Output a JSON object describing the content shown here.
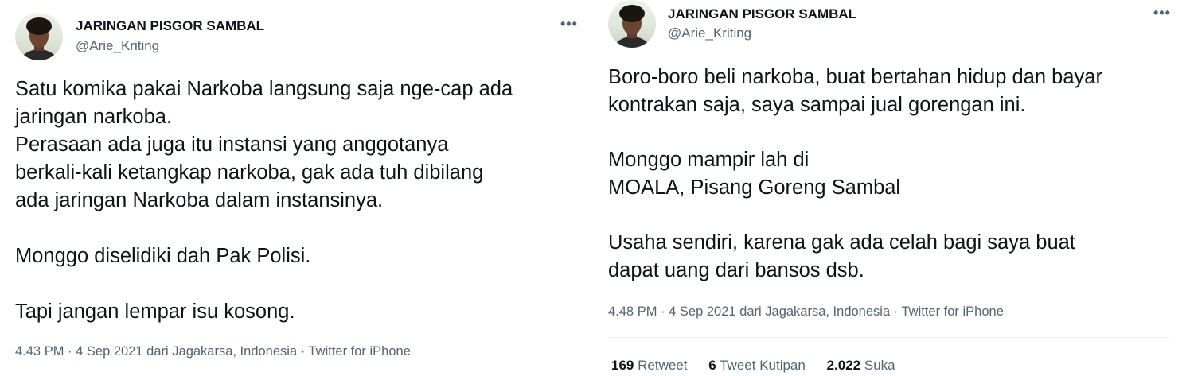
{
  "tweet1": {
    "author": {
      "name": "JARINGAN PISGOR SAMBAL",
      "handle": "@Arie_Kriting"
    },
    "more_icon": "more-horizontal-icon",
    "lines": [
      "Satu komika pakai Narkoba langsung saja nge-cap ada",
      "jaringan narkoba.",
      "Perasaan ada juga itu instansi yang anggotanya",
      "berkali-kali ketangkap narkoba, gak ada tuh dibilang",
      "ada jaringan Narkoba dalam instansinya.",
      "Monggo diselidiki dah Pak Polisi.",
      "Tapi jangan lempar isu kosong."
    ],
    "meta": {
      "time": "4.43 PM",
      "date": "4 Sep 2021",
      "from_label": "dari",
      "location": "Jagakarsa, Indonesia",
      "source": "Twitter for iPhone"
    }
  },
  "tweet2": {
    "author": {
      "name": "JARINGAN PISGOR SAMBAL",
      "handle": "@Arie_Kriting"
    },
    "more_icon": "more-horizontal-icon",
    "lines": [
      "Boro-boro beli narkoba, buat bertahan hidup dan bayar",
      "kontrakan saja, saya sampai jual gorengan ini.",
      "Monggo mampir lah di",
      "MOALA, Pisang Goreng Sambal",
      "Usaha sendiri, karena gak ada celah bagi saya buat",
      "dapat uang dari bansos dsb."
    ],
    "meta": {
      "time": "4.48 PM",
      "date": "4 Sep 2021",
      "from_label": "dari",
      "location": "Jagakarsa, Indonesia",
      "source": "Twitter for iPhone"
    },
    "stats": {
      "retweets_count": "169",
      "retweets_label": "Retweet",
      "quotes_count": "6",
      "quotes_label": "Tweet Kutipan",
      "likes_count": "2.022",
      "likes_label": "Suka"
    }
  },
  "colors": {
    "text": "#0f1419",
    "secondary": "#536471",
    "divider": "#eff3f4"
  }
}
